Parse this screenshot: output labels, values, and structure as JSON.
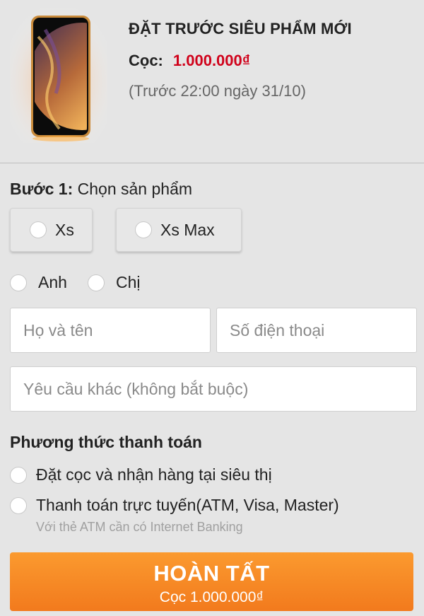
{
  "header": {
    "title": "ĐẶT TRƯỚC SIÊU PHẨM MỚI",
    "deposit_label": "Cọc:",
    "deposit_amount": "1.000.000₫",
    "deadline": "(Trước 22:00 ngày 31/10)"
  },
  "step1": {
    "label_bold": "Bước 1:",
    "label_text": " Chọn sản phẩm",
    "options": [
      {
        "label": "Xs"
      },
      {
        "label": "Xs Max"
      }
    ]
  },
  "gender": {
    "options": [
      {
        "label": "Anh"
      },
      {
        "label": "Chị"
      }
    ]
  },
  "form": {
    "name_placeholder": "Họ và tên",
    "phone_placeholder": "Số điện thoại",
    "note_placeholder": "Yêu cầu khác (không bắt buộc)"
  },
  "payment": {
    "title": "Phương thức thanh toán",
    "options": [
      {
        "label": "Đặt cọc và nhận hàng tại siêu thị"
      },
      {
        "label": "Thanh toán trực tuyến(ATM, Visa, Master)"
      }
    ],
    "note": "Với thẻ ATM cần có Internet Banking"
  },
  "submit": {
    "label": "HOÀN TẤT",
    "sublabel": "Cọc 1.000.000₫"
  },
  "colors": {
    "accent": "#d0021b",
    "button": "#f7891f",
    "background": "#e5e5e5"
  }
}
